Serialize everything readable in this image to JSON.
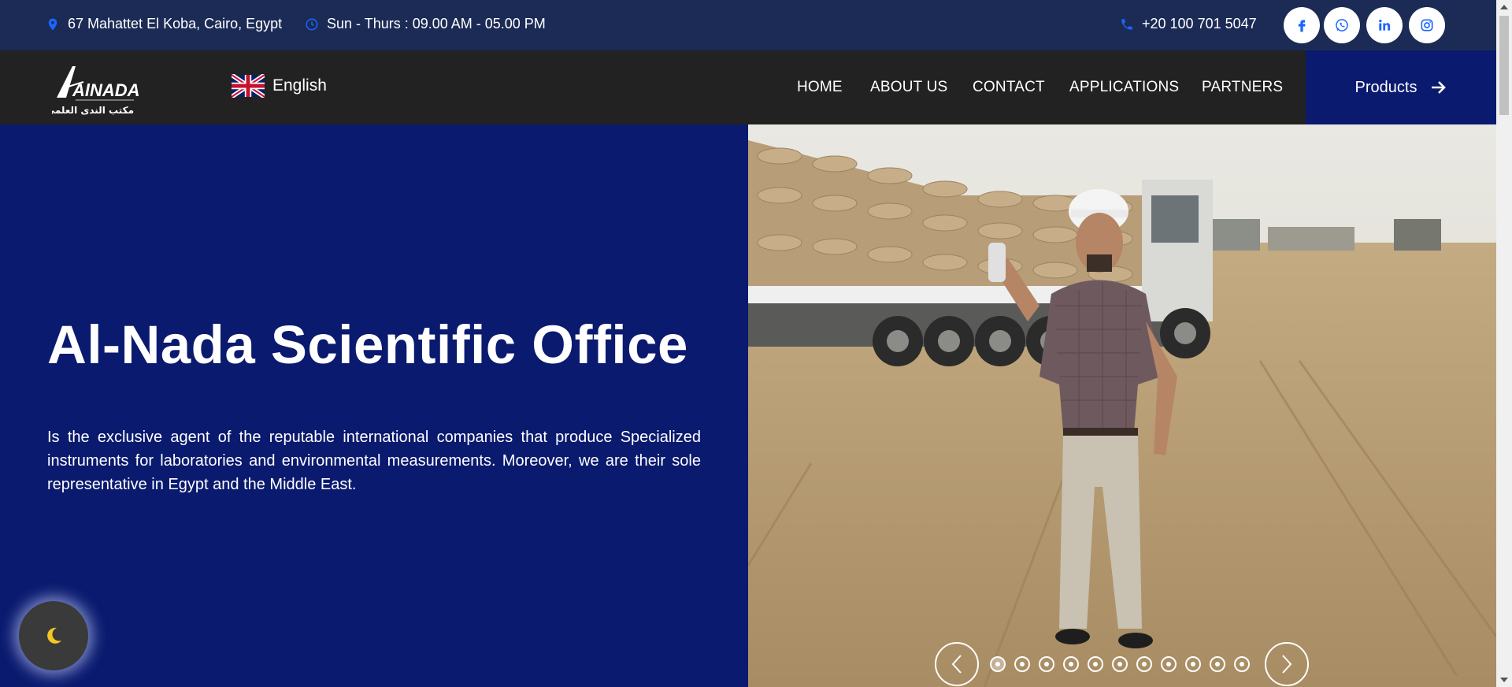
{
  "topbar": {
    "address": "67 Mahattet El Koba, Cairo, Egypt",
    "hours": "Sun - Thurs : 09.00 AM - 05.00 PM",
    "phone": "+20 100 701 5047",
    "social": [
      "facebook-icon",
      "whatsapp-icon",
      "linkedin-icon",
      "instagram-icon"
    ]
  },
  "nav": {
    "logo_text": "AlNADA",
    "logo_arabic": "مكتب الندى العلمي",
    "language": "English",
    "menu": [
      "HOME",
      "ABOUT US",
      "CONTACT",
      "APPLICATIONS",
      "PARTNERS"
    ],
    "products": "Products"
  },
  "hero": {
    "title": "Al-Nada Scientific Office",
    "description": "Is the exclusive agent of the reputable international companies that produce Specialized instruments for laboratories and environmental measurements. Moreover, we are their sole representative in Egypt and the Middle East."
  },
  "slider": {
    "dot_count": 11,
    "active_index": 0
  },
  "colors": {
    "topbar": "#1b2b55",
    "nav": "#222222",
    "brand_blue": "#0a1a6e",
    "icon_blue": "#1a66ff"
  }
}
